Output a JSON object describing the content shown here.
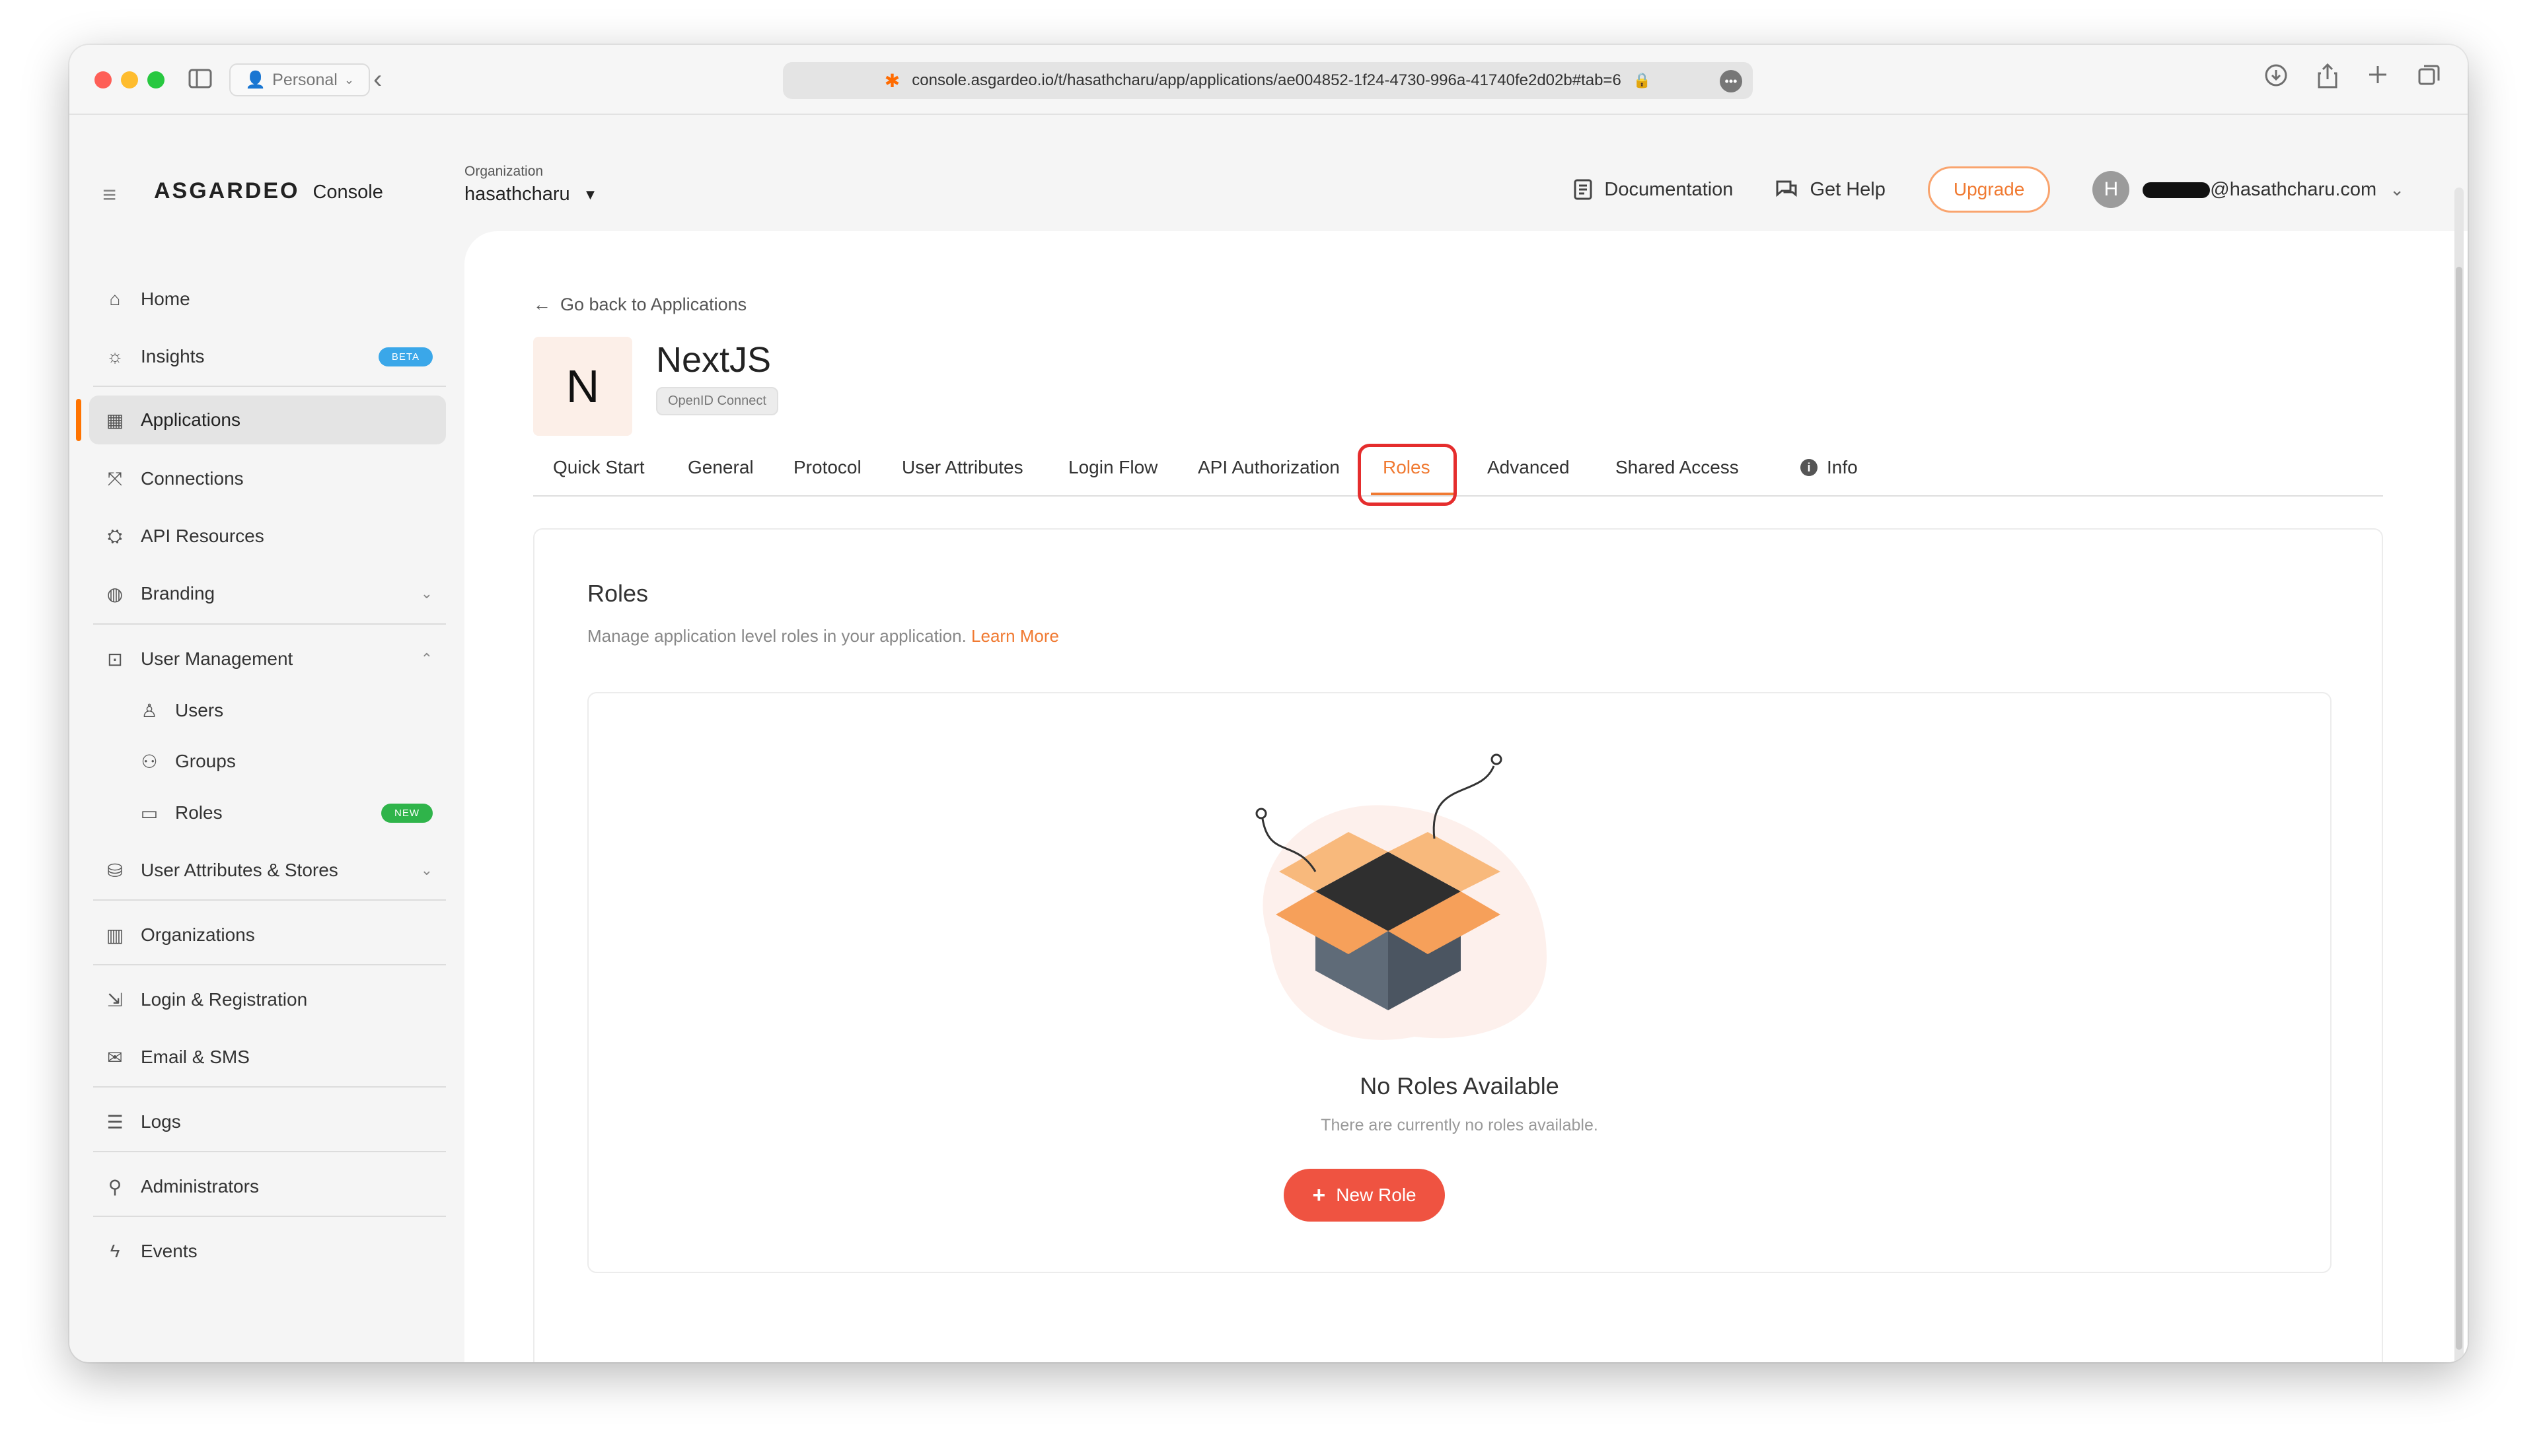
{
  "browser": {
    "profile_label": "Personal",
    "url": "console.asgardeo.io/t/hasathcharu/app/applications/ae004852-1f24-4730-996a-41740fe2d02b#tab=6"
  },
  "header": {
    "brand": "ASGARDEO",
    "product": "Console",
    "org_label": "Organization",
    "org_value": "hasathcharu",
    "documentation": "Documentation",
    "get_help": "Get Help",
    "upgrade": "Upgrade",
    "avatar_initial": "H",
    "user_email_suffix": "@hasathcharu.com"
  },
  "sidebar": {
    "items": [
      {
        "label": "Home",
        "icon": "home-icon"
      },
      {
        "label": "Insights",
        "icon": "lightbulb-icon",
        "badge": "BETA"
      },
      {
        "label": "Applications",
        "icon": "grid-icon",
        "active": true
      },
      {
        "label": "Connections",
        "icon": "connections-icon"
      },
      {
        "label": "API Resources",
        "icon": "api-icon"
      },
      {
        "label": "Branding",
        "icon": "palette-icon"
      },
      {
        "label": "User Management",
        "icon": "user-management-icon"
      },
      {
        "label": "Users",
        "icon": "user-icon"
      },
      {
        "label": "Groups",
        "icon": "groups-icon"
      },
      {
        "label": "Roles",
        "icon": "roles-icon",
        "badge": "NEW"
      },
      {
        "label": "User Attributes & Stores",
        "icon": "attributes-icon"
      },
      {
        "label": "Organizations",
        "icon": "building-icon"
      },
      {
        "label": "Login & Registration",
        "icon": "login-icon"
      },
      {
        "label": "Email & SMS",
        "icon": "email-icon"
      },
      {
        "label": "Logs",
        "icon": "logs-icon"
      },
      {
        "label": "Administrators",
        "icon": "admin-icon"
      },
      {
        "label": "Events",
        "icon": "bolt-icon"
      }
    ]
  },
  "main": {
    "back_link": "Go back to Applications",
    "app_initial": "N",
    "app_name": "NextJS",
    "protocol": "OpenID Connect",
    "tabs": [
      {
        "label": "Quick Start"
      },
      {
        "label": "General"
      },
      {
        "label": "Protocol"
      },
      {
        "label": "User Attributes"
      },
      {
        "label": "Login Flow"
      },
      {
        "label": "API Authorization"
      },
      {
        "label": "Roles",
        "active": true
      },
      {
        "label": "Advanced"
      },
      {
        "label": "Shared Access"
      },
      {
        "label": "Info"
      }
    ],
    "card": {
      "title": "Roles",
      "description": "Manage application level roles in your application.",
      "learn_more": "Learn More",
      "empty_title": "No Roles Available",
      "empty_subtitle": "There are currently no roles available.",
      "new_role_button": "New Role"
    }
  },
  "colors": {
    "accent": "#f07a32",
    "active_bar": "#ff7300",
    "primary_button": "#ef5341",
    "highlight_box": "#e52d2d",
    "beta_badge": "#3aa7e9",
    "new_badge": "#2fb44a"
  }
}
